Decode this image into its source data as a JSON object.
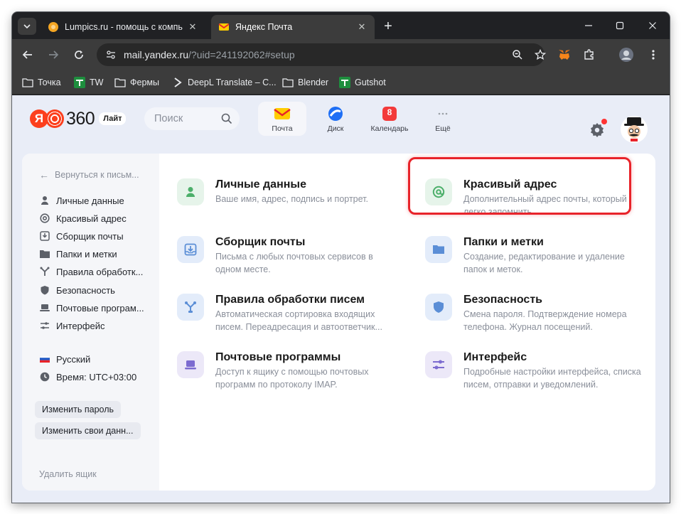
{
  "browser": {
    "tabs": [
      {
        "title": "Lumpics.ru - помощь с компьютером",
        "close": "✕"
      },
      {
        "title": "Яндекс Почта",
        "close": "✕"
      }
    ],
    "new_tab": "+",
    "url_host": "mail.yandex.ru",
    "url_path": "/?uid=241192062#setup",
    "bookmarks": [
      "Точка",
      "TW",
      "Фермы",
      "DeepL Translate – C...",
      "Blender",
      "Gutshot"
    ]
  },
  "header": {
    "logo_text": "360",
    "logo_badge": "Лайт",
    "search_placeholder": "Поиск",
    "apps": [
      {
        "label": "Почта"
      },
      {
        "label": "Диск"
      },
      {
        "label": "Календарь",
        "badge": "8"
      },
      {
        "label": "Ещё"
      }
    ]
  },
  "sidebar": {
    "back": "Вернуться к письм...",
    "items": [
      {
        "label": "Личные данные"
      },
      {
        "label": "Красивый адрес"
      },
      {
        "label": "Сборщик почты"
      },
      {
        "label": "Папки и метки"
      },
      {
        "label": "Правила обработк..."
      },
      {
        "label": "Безопасность"
      },
      {
        "label": "Почтовые програм..."
      },
      {
        "label": "Интерфейс"
      }
    ],
    "language": "Русский",
    "time": "Время: UTC+03:00",
    "change_password": "Изменить пароль",
    "change_data": "Изменить свои данн...",
    "delete": "Удалить ящик"
  },
  "settings": [
    {
      "title": "Личные данные",
      "desc": "Ваше имя, адрес, подпись и портрет."
    },
    {
      "title": "Красивый адрес",
      "desc": "Дополнительный адрес почты, который легко запомнить."
    },
    {
      "title": "Сборщик почты",
      "desc": "Письма с любых почтовых сервисов в одном месте."
    },
    {
      "title": "Папки и метки",
      "desc": "Создание, редактирование и удаление папок и меток."
    },
    {
      "title": "Правила обработки писем",
      "desc": "Автоматическая сортировка входящих писем. Переадресация и автоответчик..."
    },
    {
      "title": "Безопасность",
      "desc": "Смена пароля. Подтверждение номера телефона. Журнал посещений."
    },
    {
      "title": "Почтовые программы",
      "desc": "Доступ к ящику с помощью почтовых программ по протоколу IMAP."
    },
    {
      "title": "Интерфейс",
      "desc": "Подробные настройки интерфейса, списка писем, отправки и уведомлений."
    }
  ],
  "colors": {
    "highlight": "#e8232a",
    "icon_green_bg": "#e6f4ea",
    "icon_green": "#4caf6a",
    "icon_blue_bg": "#e3ecfa",
    "icon_blue": "#5b8ed6",
    "icon_purple_bg": "#ece8f8",
    "icon_purple": "#7c6bd0"
  }
}
